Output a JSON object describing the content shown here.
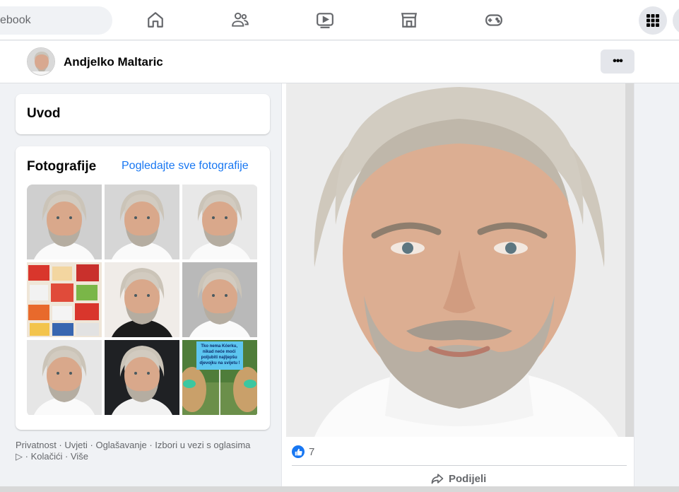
{
  "search": {
    "value": "ebook"
  },
  "nav": {
    "icons": [
      "home-icon",
      "friends-icon",
      "watch-icon",
      "marketplace-icon",
      "gaming-icon",
      "menu-grid-icon"
    ]
  },
  "profile": {
    "name": "Andjelko Maltaric",
    "more_label": "•••"
  },
  "intro": {
    "title": "Uvod"
  },
  "photos": {
    "title": "Fotografije",
    "see_all": "Pogledajte sve fotografije",
    "promo_text": "Tko nema Kćerku, nikad neće moći poljubiti najljepšu djevojku na svijetu !"
  },
  "footer": {
    "links": [
      "Privatnost",
      "Uvjeti",
      "Oglašavanje",
      "Izbori u vezi s oglasima",
      "Kolačići",
      "Više"
    ],
    "separator": " · "
  },
  "post": {
    "like_count": "7",
    "share_label": "Podijeli"
  },
  "colors": {
    "accent": "#1877f2",
    "background": "#f0f2f5",
    "secondary_text": "#65676b"
  }
}
